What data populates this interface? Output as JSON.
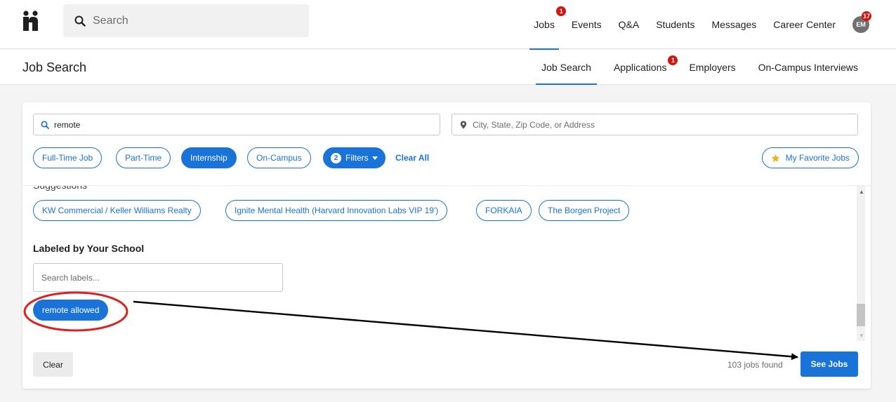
{
  "search": {
    "placeholder": "Search"
  },
  "nav": {
    "items": [
      {
        "label": "Jobs",
        "badge": "1",
        "active": true
      },
      {
        "label": "Events"
      },
      {
        "label": "Q&A"
      },
      {
        "label": "Students"
      },
      {
        "label": "Messages"
      },
      {
        "label": "Career Center"
      }
    ],
    "avatar": {
      "initials": "EM",
      "badge": "17"
    }
  },
  "subnav": {
    "title": "Job Search",
    "tabs": [
      {
        "label": "Job Search",
        "active": true
      },
      {
        "label": "Applications",
        "badge": "1"
      },
      {
        "label": "Employers"
      },
      {
        "label": "On-Campus Interviews"
      }
    ]
  },
  "filters": {
    "keyword": "remote",
    "location_placeholder": "City, State, Zip Code, or Address",
    "chips": [
      {
        "label": "Full-Time Job",
        "active": false
      },
      {
        "label": "Part-Time",
        "active": false
      },
      {
        "label": "Internship",
        "active": true
      },
      {
        "label": "On-Campus",
        "active": false
      }
    ],
    "filters_count": "2",
    "filters_label": "Filters",
    "clear_all": "Clear All",
    "favorite": "My Favorite Jobs"
  },
  "panel": {
    "suggestions_heading": "Suggestions",
    "suggestions": [
      "KW Commercial / Keller Williams Realty",
      "Ignite Mental Health (Harvard Innovation Labs VIP 19')",
      "FORKAIA",
      "The Borgen Project"
    ],
    "label_heading": "Labeled by Your School",
    "label_placeholder": "Search labels...",
    "selected_label": "remote allowed"
  },
  "footer": {
    "clear": "Clear",
    "jobs_found": "103 jobs found",
    "see_jobs": "See Jobs"
  },
  "colors": {
    "accent": "#1a73d9",
    "badge": "#d4140e",
    "annotation": "#e02020"
  }
}
